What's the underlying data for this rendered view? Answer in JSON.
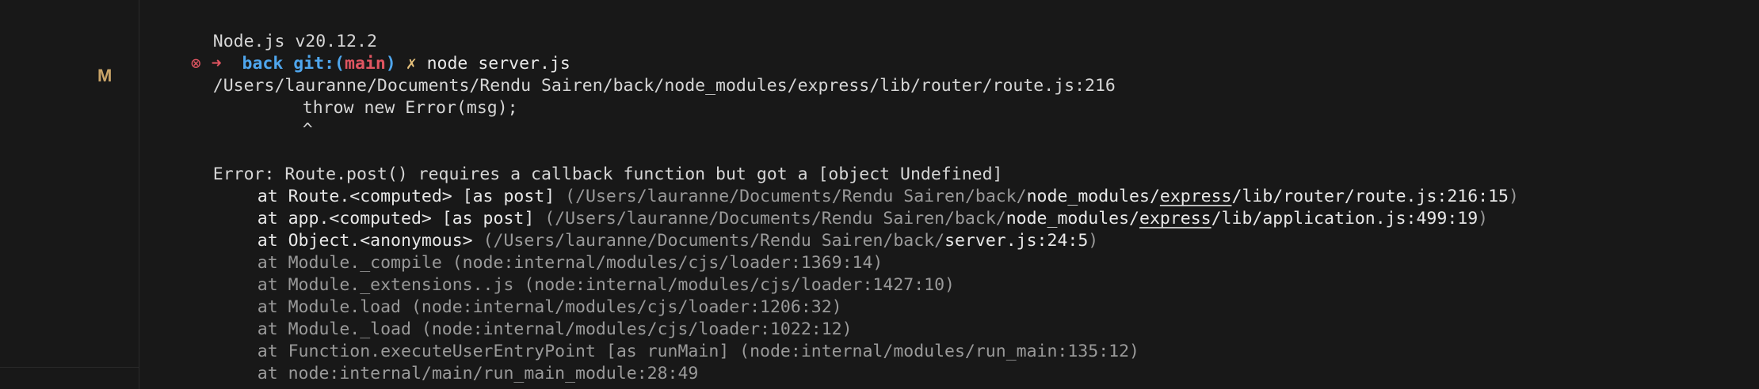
{
  "editor": {
    "gutter_badge": "M"
  },
  "terminal": {
    "node_version": "Node.js v20.12.2",
    "prompt": {
      "error_icon": "⊗",
      "arrow": "➜",
      "directory": "back",
      "git_label": "git:",
      "paren_open": "(",
      "branch": "main",
      "paren_close": ")",
      "dirty_marker": "✗",
      "command": "node server.js"
    },
    "stack_file": "/Users/lauranne/Documents/Rendu Sairen/back/node_modules/express/lib/router/route.js:216",
    "code_line": "throw new Error(msg);",
    "caret": "^",
    "error_message": "Error: Route.post() requires a callback function but got a [object Undefined]",
    "frames": [
      {
        "prefix": "at Route.<computed> [as post] ",
        "paren_open": "(",
        "path_dim": "/Users/lauranne/Documents/Rendu Sairen/back/",
        "p1": "node_modules/",
        "p2": "express",
        "p3": "/lib/router/route.js:216:15",
        "paren_close": ")"
      },
      {
        "prefix": "at app.<computed> [as post] ",
        "paren_open": "(",
        "path_dim": "/Users/lauranne/Documents/Rendu Sairen/back/",
        "p1": "node_modules/",
        "p2": "express",
        "p3": "/lib/application.js:499:19",
        "paren_close": ")"
      },
      {
        "prefix": "at Object.<anonymous> ",
        "paren_open": "(",
        "path_dim": "/Users/lauranne/Documents/Rendu Sairen/back/",
        "p1": "server.js:24:5",
        "paren_close": ")"
      }
    ],
    "internal_frames": [
      "at Module._compile (node:internal/modules/cjs/loader:1369:14)",
      "at Module._extensions..js (node:internal/modules/cjs/loader:1427:10)",
      "at Module.load (node:internal/modules/cjs/loader:1206:32)",
      "at Module._load (node:internal/modules/cjs/loader:1022:12)",
      "at Function.executeUserEntryPoint [as runMain] (node:internal/modules/run_main:135:12)",
      "at node:internal/main/run_main_module:28:49"
    ]
  },
  "colors": {
    "background": "#181818",
    "text": "#d6d6d6",
    "dim_text": "#9a9a9a",
    "error_red": "#e05561",
    "prompt_blue": "#4fa6ed",
    "dirty_yellow": "#e5c07b",
    "badge_gold": "#c9a468"
  }
}
